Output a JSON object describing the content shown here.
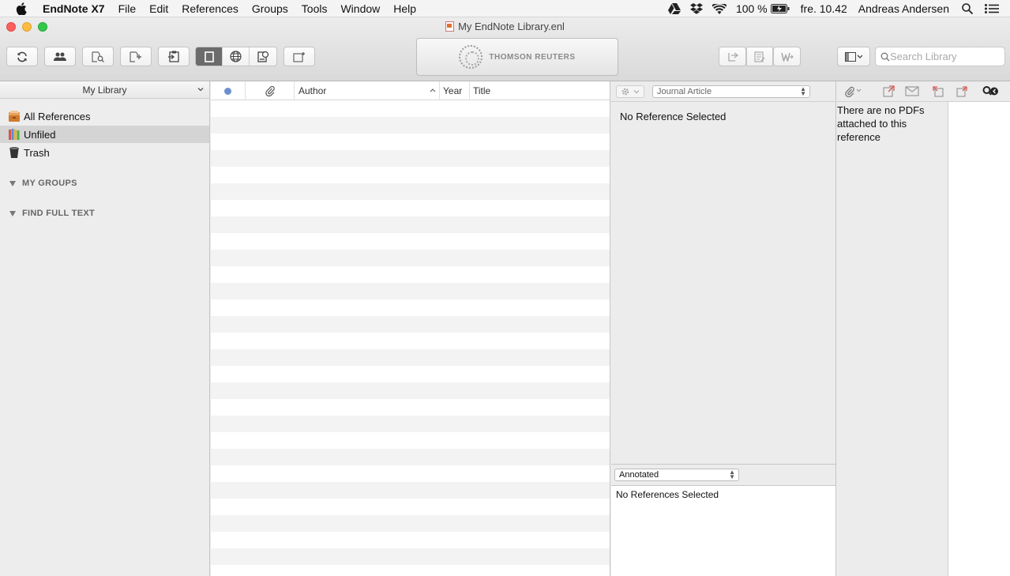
{
  "menubar": {
    "app_name": "EndNote X7",
    "menus": [
      "File",
      "Edit",
      "References",
      "Groups",
      "Tools",
      "Window",
      "Help"
    ],
    "battery": "100 %",
    "clock": "fre. 10.42",
    "user": "Andreas Andersen"
  },
  "window": {
    "title": "My EndNote Library.enl",
    "brand": "THOMSON REUTERS",
    "search_placeholder": "Search Library"
  },
  "sidebar": {
    "library_selector": "My Library",
    "items": [
      {
        "label": "All References",
        "icon": "all-references-icon"
      },
      {
        "label": "Unfiled",
        "icon": "unfiled-icon"
      },
      {
        "label": "Trash",
        "icon": "trash-icon"
      }
    ],
    "groups": [
      "MY GROUPS",
      "FIND FULL TEXT"
    ]
  },
  "reference_list": {
    "columns": [
      "Author",
      "Year",
      "Title"
    ]
  },
  "reference_panel": {
    "reference_type": "Journal Article",
    "empty_message": "No Reference Selected",
    "style": "Annotated",
    "preview_message": "No References Selected"
  },
  "pdf_panel": {
    "message": "There are no PDFs attached to this reference"
  },
  "colors": {
    "close": "#fc605c",
    "minimize": "#fdbc40",
    "maximize": "#34c84a",
    "read_dot": "#6c8fcf"
  }
}
